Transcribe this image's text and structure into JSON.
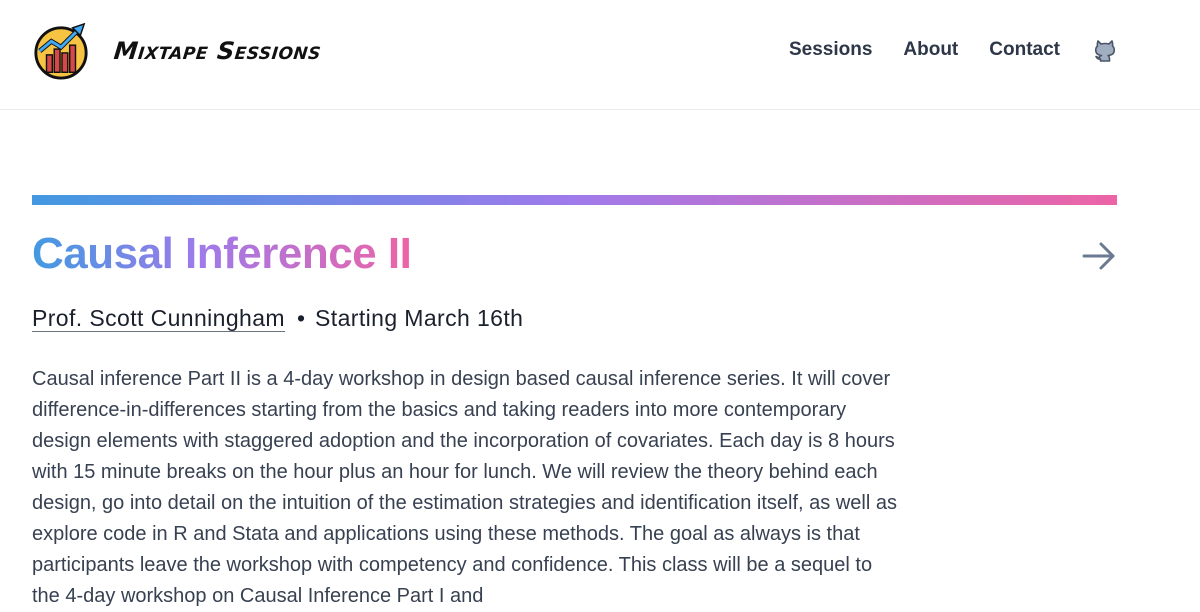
{
  "header": {
    "brand": "Mixtape Sessions",
    "nav": [
      {
        "label": "Sessions"
      },
      {
        "label": "About"
      },
      {
        "label": "Contact"
      }
    ],
    "github_icon": "github-icon"
  },
  "course": {
    "title": "Causal Inference II",
    "instructor": "Prof. Scott Cunningham",
    "separator": "•",
    "start": "Starting March 16th",
    "arrow_icon": "arrow-right-icon",
    "description": "Causal inference Part II is a 4-day workshop in design based causal inference series. It will cover difference-in-differences starting from the basics and taking readers into more contemporary design elements with staggered adoption and the incorporation of covariates. Each day is 8 hours with 15 minute breaks on the hour plus an hour for lunch. We will review the theory behind each design, go into detail on the intuition of the estimation strategies and identification itself, as well as explore code in R and Stata and applications using these methods. The goal as always is that participants leave the workshop with competency and confidence. This class will be a sequel to the 4-day workshop on Causal Inference Part I and"
  },
  "colors": {
    "gradient_start": "#4299e1",
    "gradient_mid": "#9f7aea",
    "gradient_end": "#ed64a6",
    "text": "#2d3748"
  }
}
